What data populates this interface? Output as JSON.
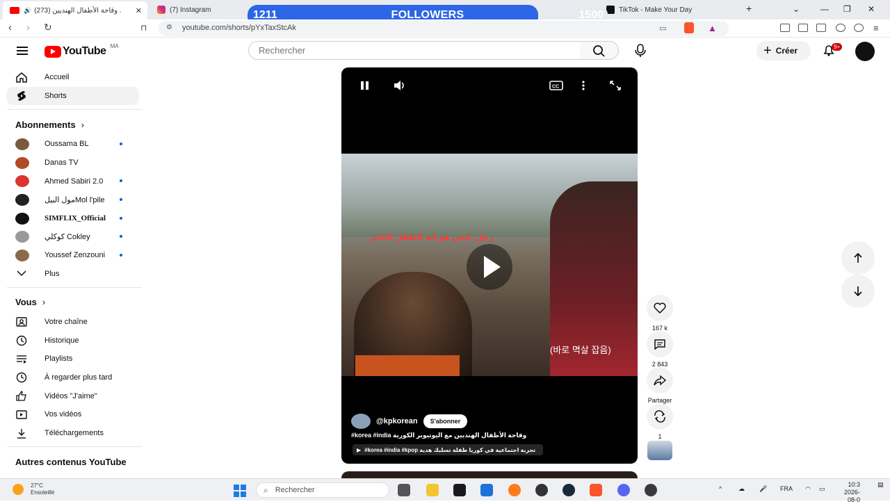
{
  "browser": {
    "tabs": [
      {
        "title": "(273) وقاحة الأطفال الهنديين ."
      },
      {
        "title": "(7) Instagram"
      },
      {
        "title": "TikTok - Make Your Day"
      }
    ],
    "url": "youtube.com/shorts/pYxTaxStcAk"
  },
  "followers_overlay": {
    "current": "1211",
    "label": "FOLLOWERS",
    "goal": "1500",
    "progress": 0.807,
    "fill_color": "#2c66e6"
  },
  "header": {
    "logo_text": "YouTube",
    "country_code": "MA",
    "search_placeholder": "Rechercher",
    "create_label": "Créer",
    "notif_badge": "9+"
  },
  "sidebar": {
    "main": [
      {
        "label": "Accueil",
        "icon": "home-icon"
      },
      {
        "label": "Shorts",
        "icon": "shorts-icon"
      }
    ],
    "subs_title": "Abonnements",
    "subscriptions": [
      {
        "label": "Oussama BL",
        "dot": true,
        "color": "#7a5a3c"
      },
      {
        "label": "Danas TV",
        "dot": false,
        "color": "#b24a2a"
      },
      {
        "label": "Ahmed Sabiri 2.0",
        "dot": true,
        "color": "#d33"
      },
      {
        "label": "مول البيلMol l'pile",
        "dot": true,
        "color": "#222"
      },
      {
        "label": "SIMFLIX_Official",
        "dot": true,
        "color": "#111"
      },
      {
        "label": "كوكلي Cokley",
        "dot": true,
        "color": "#999"
      },
      {
        "label": "Youssef Zenzouni",
        "dot": true,
        "color": "#8a6a4a"
      }
    ],
    "more_label": "Plus",
    "you_title": "Vous",
    "you_items": [
      {
        "label": "Votre chaîne",
        "icon": "channel-icon"
      },
      {
        "label": "Historique",
        "icon": "history-icon"
      },
      {
        "label": "Playlists",
        "icon": "playlists-icon"
      },
      {
        "label": "À regarder plus tard",
        "icon": "watch-later-icon"
      },
      {
        "label": "Vidéos \"J'aime\"",
        "icon": "liked-icon"
      },
      {
        "label": "Vos vidéos",
        "icon": "your-videos-icon"
      },
      {
        "label": "Téléchargements",
        "icon": "downloads-icon"
      }
    ],
    "more_title": "Autres contenus YouTube"
  },
  "player": {
    "caption_ar": "رجل: ليس هو انه الطفل الثاني",
    "caption_ko": "(바로 멱살 잡음)",
    "channel": "@kpkorean",
    "subscribe_label": "S'abonner",
    "title": "#korea #india وقاحة الأطفال الهنديين مع اليوتيوبر الكورية",
    "sound": "#korea #india #kpop تجربة اجتماعية في كوريا طفلة تسلبك هدية"
  },
  "actions": {
    "likes": "167 k",
    "comments": "2 843",
    "share_label": "Partager",
    "remix_count": "1"
  },
  "taskbar": {
    "temp": "27°C",
    "weather": "Ensoleillé",
    "search_placeholder": "Rechercher",
    "lang": "FRA",
    "time": "10:3",
    "date": "2026-08-0"
  }
}
